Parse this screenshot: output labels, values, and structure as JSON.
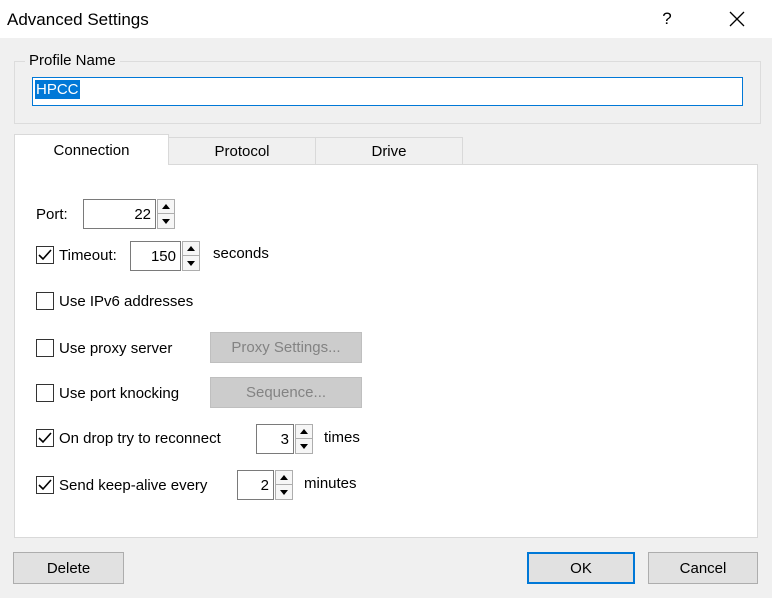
{
  "window": {
    "title": "Advanced Settings",
    "help": "?"
  },
  "profile": {
    "group_label": "Profile Name",
    "value": "HPCC"
  },
  "tabs": [
    {
      "label": "Connection"
    },
    {
      "label": "Protocol"
    },
    {
      "label": "Drive"
    }
  ],
  "connection": {
    "port": {
      "label": "Port:",
      "value": "22"
    },
    "timeout": {
      "label": "Timeout:",
      "checked": true,
      "value": "150",
      "unit": "seconds"
    },
    "ipv6": {
      "label": "Use IPv6 addresses",
      "checked": false
    },
    "proxy": {
      "label": "Use proxy server",
      "checked": false,
      "button": "Proxy Settings..."
    },
    "knocking": {
      "label": "Use port knocking",
      "checked": false,
      "button": "Sequence..."
    },
    "reconnect": {
      "label": "On drop try to reconnect",
      "checked": true,
      "value": "3",
      "unit": "times"
    },
    "keepalive": {
      "label": "Send keep-alive every",
      "checked": true,
      "value": "2",
      "unit": "minutes"
    }
  },
  "buttons": {
    "delete": "Delete",
    "ok": "OK",
    "cancel": "Cancel"
  }
}
